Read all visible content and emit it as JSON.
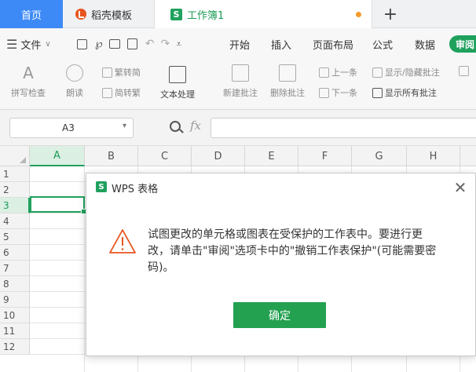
{
  "titlebar": {
    "tabs": [
      {
        "label": "首页"
      },
      {
        "label": "稻壳模板"
      },
      {
        "label": "工作簿1"
      }
    ],
    "new_tab": "+",
    "unsaved_color": "#f39a29"
  },
  "menubar": {
    "file": "文件",
    "items": [
      "开始",
      "插入",
      "页面布局",
      "公式",
      "数据"
    ],
    "active_tab": "审阅"
  },
  "ribbon": {
    "spellcheck": "拼写检查",
    "read_aloud": "朗读",
    "trad_to_simp": "繁转简",
    "simp_to_trad": "简转繁",
    "text_processing": "文本处理",
    "new_comment": "新建批注",
    "delete_comment": "删除批注",
    "prev_comment": "上一条",
    "next_comment": "下一条",
    "show_hide_comment": "显示/隐藏批注",
    "show_all_comments": "显示所有批注"
  },
  "formula_bar": {
    "cell_ref": "A3",
    "fx": "fx",
    "value": ""
  },
  "grid": {
    "columns": [
      "A",
      "B",
      "C",
      "D",
      "E",
      "F",
      "G",
      "H"
    ],
    "rows": [
      "1",
      "2",
      "3",
      "4",
      "5",
      "6",
      "7",
      "8",
      "9",
      "10",
      "11",
      "12"
    ],
    "selected_cell": "A3"
  },
  "dialog": {
    "app_logo": "S",
    "title": "WPS 表格",
    "message": "试图更改的单元格或图表在受保护的工作表中。要进行更改，请单击\"审阅\"选项卡中的\"撤销工作表保护\"(可能需要密码)。",
    "ok_label": "确定"
  },
  "colors": {
    "accent_green": "#1fa15d",
    "home_tab_blue": "#3d8af7",
    "warning_orange": "#e8541e"
  }
}
